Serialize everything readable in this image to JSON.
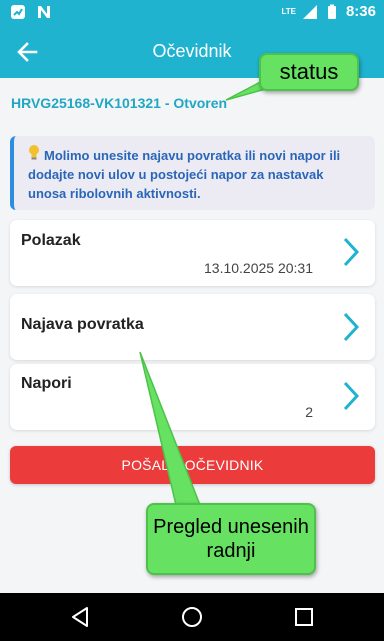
{
  "status_bar": {
    "time": "8:36",
    "network": "LTE"
  },
  "app_bar": {
    "title": "Očevidnik",
    "back_icon": "arrow-left-icon"
  },
  "reference": {
    "text": "HRVG25168-VK101321 - Otvoren"
  },
  "info": {
    "text": "Molimo unesite najavu povratka ili novi napor ili dodajte novi ulov u postojeći napor za nastavak unosa ribolovnih aktivnosti.",
    "icon": "lightbulb-icon"
  },
  "cards": [
    {
      "title": "Polazak",
      "value": "13.10.2025 20:31"
    },
    {
      "title": "Najava povratka",
      "value": ""
    },
    {
      "title": "Napori",
      "value": "2"
    }
  ],
  "send_button": {
    "label": "POŠALJI OČEVIDNIK"
  },
  "callouts": {
    "status": "status",
    "pregled": "Pregled unesenih radnji"
  },
  "colors": {
    "primary": "#1fb3d0",
    "accent_red": "#ec3b3b",
    "link_blue": "#21a7c4",
    "callout_green": "#66e162"
  }
}
